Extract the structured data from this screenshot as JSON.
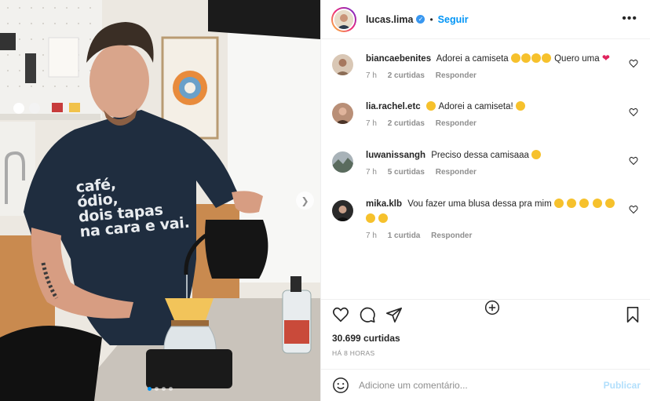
{
  "post": {
    "shirt_lines": [
      "café,",
      "ódio,",
      "dois tapas",
      "na cara e vai."
    ],
    "carousel_dots": 4,
    "carousel_active": 0
  },
  "header": {
    "username": "lucas.lima",
    "separator": "•",
    "follow_label": "Seguir",
    "more_icon": "more-options-icon"
  },
  "comments": [
    {
      "user": "biancaebenites",
      "text_before": "Adorei a camiseta",
      "emoji_before": 4,
      "text_after": "Quero uma",
      "heart": "❤",
      "emoji_after": 0,
      "time": "7 h",
      "likes": "2 curtidas",
      "reply": "Responder"
    },
    {
      "user": "lia.rachel.etc",
      "text_before": "Adorei a camiseta!",
      "emoji_before": 0,
      "lead_emoji": 1,
      "text_after": "",
      "emoji_after": 1,
      "time": "7 h",
      "likes": "2 curtidas",
      "reply": "Responder"
    },
    {
      "user": "luwanissangh",
      "text_before": "Preciso dessa camisaaa",
      "emoji_before": 1,
      "text_after": "",
      "emoji_after": 0,
      "time": "7 h",
      "likes": "5 curtidas",
      "reply": "Responder"
    },
    {
      "user": "mika.klb",
      "text_before": "Vou fazer uma blusa dessa pra mim",
      "emoji_before": 7,
      "text_after": "",
      "emoji_after": 0,
      "time": "7 h",
      "likes": "1 curtida",
      "reply": "Responder"
    }
  ],
  "actions": {
    "likes": "30.699 curtidas",
    "posted": "HÁ 8 HORAS"
  },
  "composer": {
    "placeholder": "Adicione um comentário...",
    "publish_label": "Publicar"
  },
  "colors": {
    "accent": "#0095f6",
    "shirt": "#1f2d3f",
    "muted": "#8e8e8e"
  }
}
